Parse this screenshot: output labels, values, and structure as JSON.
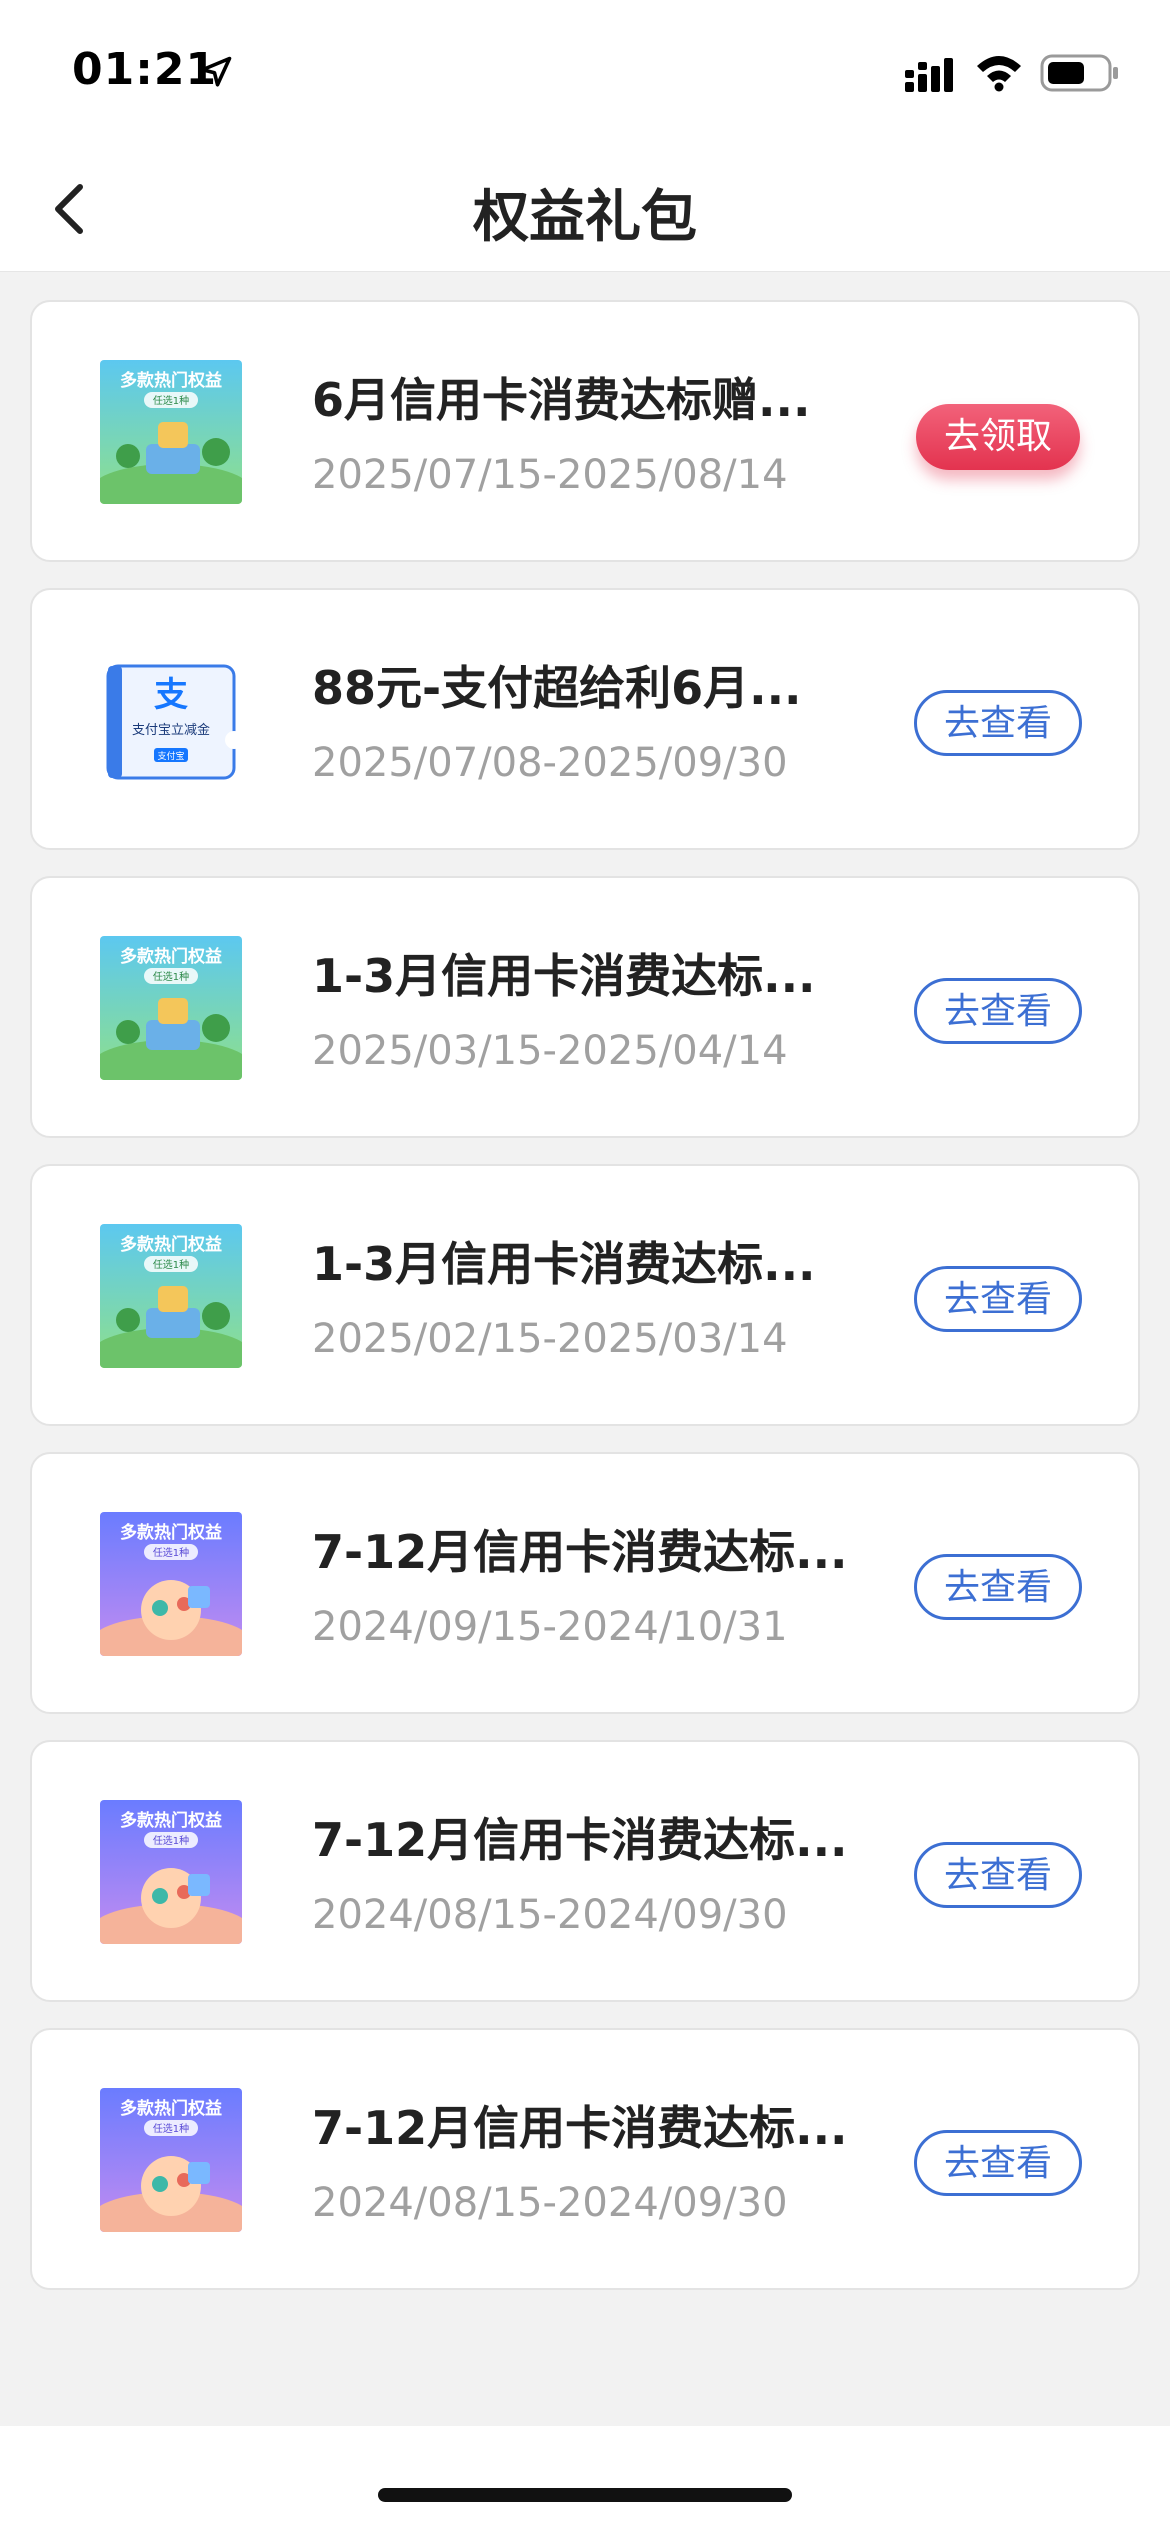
{
  "status_bar": {
    "time": "01:21"
  },
  "nav": {
    "title": "权益礼包"
  },
  "items": [
    {
      "title": "6月信用卡消费达标赠...",
      "date": "2025/07/15-2025/08/14",
      "button": "去领取",
      "button_style": "primary",
      "thumb": "promo-green"
    },
    {
      "title": "88元-支付超给利6月...",
      "date": "2025/07/08-2025/09/30",
      "button": "去查看",
      "button_style": "outline",
      "thumb": "alipay-coupon"
    },
    {
      "title": "1-3月信用卡消费达标...",
      "date": "2025/03/15-2025/04/14",
      "button": "去查看",
      "button_style": "outline",
      "thumb": "promo-green"
    },
    {
      "title": "1-3月信用卡消费达标...",
      "date": "2025/02/15-2025/03/14",
      "button": "去查看",
      "button_style": "outline",
      "thumb": "promo-green"
    },
    {
      "title": "7-12月信用卡消费达标...",
      "date": "2024/09/15-2024/10/31",
      "button": "去查看",
      "button_style": "outline",
      "thumb": "promo-purple"
    },
    {
      "title": "7-12月信用卡消费达标...",
      "date": "2024/08/15-2024/09/30",
      "button": "去查看",
      "button_style": "outline",
      "thumb": "promo-purple"
    },
    {
      "title": "7-12月信用卡消费达标...",
      "date": "2024/08/15-2024/09/30",
      "button": "去查看",
      "button_style": "outline",
      "thumb": "promo-purple"
    }
  ],
  "thumb_text": {
    "promo_heading": "多款热门权益",
    "promo_sub": "任选1种",
    "alipay_glyph": "支",
    "alipay_label": "支付宝立减金",
    "alipay_brand": "支付宝"
  },
  "colors": {
    "accent_blue": "#3c6fd3",
    "primary_red": "#e3334f",
    "date_gray": "#a0a0a0"
  }
}
